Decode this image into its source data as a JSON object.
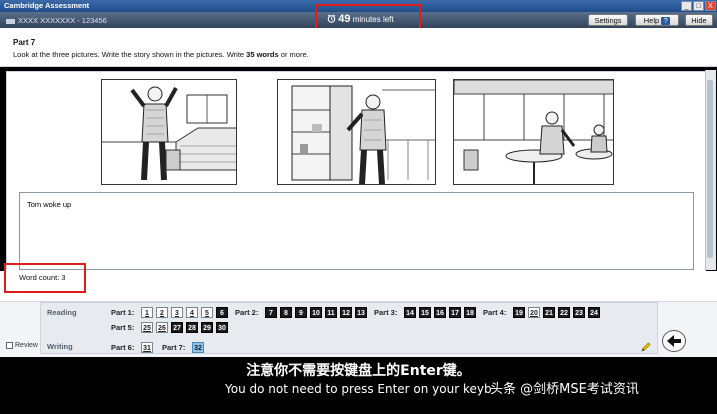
{
  "window": {
    "title": "Cambridge Assessment",
    "controls": [
      "_",
      "□",
      "X"
    ]
  },
  "header": {
    "candidate": "XXXX XXXXXXX - 123456",
    "timer_value": "49",
    "timer_suffix": "minutes left",
    "settings_label": "Settings",
    "help_label": "Help",
    "help_badge": "?",
    "hide_label": "Hide"
  },
  "task": {
    "part_title": "Part 7",
    "instruction_pre": "Look at the three pictures.  Write the story shown in the pictures.  Write ",
    "instruction_bold": "35 words",
    "instruction_post": " or more."
  },
  "answer": {
    "text": "Tom woke up",
    "word_count_label": "Word count: 3"
  },
  "nav": {
    "reading_label": "Reading",
    "writing_label": "Writing",
    "review_label": "Review",
    "reading_parts": [
      {
        "label": "Part 1:",
        "items": [
          {
            "n": "1",
            "st": "w"
          },
          {
            "n": "2",
            "st": "w"
          },
          {
            "n": "3",
            "st": "w"
          },
          {
            "n": "4",
            "st": "w"
          },
          {
            "n": "5",
            "st": "w"
          },
          {
            "n": "6",
            "st": "d"
          }
        ]
      },
      {
        "label": "Part 2:",
        "items": [
          {
            "n": "7",
            "st": "d"
          },
          {
            "n": "8",
            "st": "d"
          },
          {
            "n": "9",
            "st": "d"
          },
          {
            "n": "10",
            "st": "d"
          },
          {
            "n": "11",
            "st": "d"
          },
          {
            "n": "12",
            "st": "d"
          },
          {
            "n": "13",
            "st": "d"
          }
        ]
      },
      {
        "label": "Part 3:",
        "items": [
          {
            "n": "14",
            "st": "d"
          },
          {
            "n": "15",
            "st": "d"
          },
          {
            "n": "16",
            "st": "d"
          },
          {
            "n": "17",
            "st": "d"
          },
          {
            "n": "18",
            "st": "d"
          }
        ]
      },
      {
        "label": "Part 4:",
        "items": [
          {
            "n": "19",
            "st": "d"
          },
          {
            "n": "20",
            "st": "w"
          },
          {
            "n": "21",
            "st": "d"
          },
          {
            "n": "22",
            "st": "d"
          },
          {
            "n": "23",
            "st": "d"
          },
          {
            "n": "24",
            "st": "d"
          }
        ]
      },
      {
        "label": "Part 5:",
        "items": [
          {
            "n": "25",
            "st": "w"
          },
          {
            "n": "26",
            "st": "w"
          },
          {
            "n": "27",
            "st": "d"
          },
          {
            "n": "28",
            "st": "d"
          },
          {
            "n": "29",
            "st": "d"
          },
          {
            "n": "30",
            "st": "d"
          }
        ]
      }
    ],
    "writing_parts": [
      {
        "label": "Part 6:",
        "items": [
          {
            "n": "31",
            "st": "w"
          }
        ]
      },
      {
        "label": "Part 7:",
        "items": [
          {
            "n": "32",
            "st": "s"
          }
        ]
      }
    ]
  },
  "subtitles": {
    "chinese": "注意你不需要按键盘上的Enter键。",
    "english": "You do not need to press Enter on your keyb",
    "watermark": "头条 @剑桥MSE考试资讯"
  },
  "colors": {
    "highlight_red": "#e01b1b",
    "selected_question": "#8fc3ec",
    "answered_question": "#1b1b1b"
  }
}
